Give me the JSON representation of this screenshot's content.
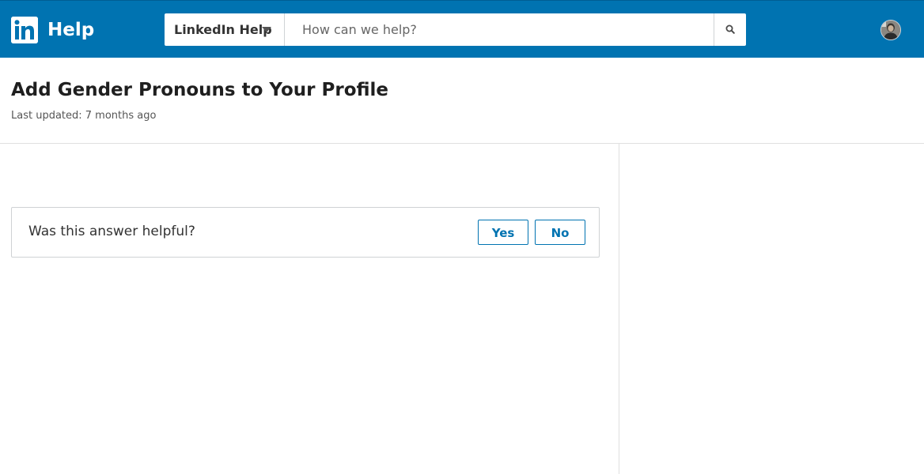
{
  "header": {
    "logo_icon": "linkedin-logo-icon",
    "title": "Help",
    "brand_color": "#0073b1",
    "search": {
      "scope_label": "LinkedIn Help",
      "placeholder": "How can we help?",
      "value": "",
      "button_icon": "search-icon"
    },
    "avatar_icon": "user-avatar"
  },
  "article": {
    "title": "Add Gender Pronouns to Your Profile",
    "last_updated": "Last updated: 7 months ago"
  },
  "feedback": {
    "question": "Was this answer helpful?",
    "yes_label": "Yes",
    "no_label": "No"
  }
}
